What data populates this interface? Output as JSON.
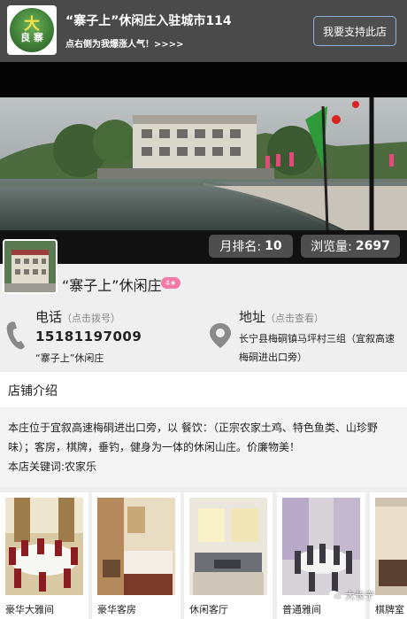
{
  "topbar": {
    "logo_text_main": "大",
    "logo_text_sub": "良 寨",
    "title": "“寨子上”休闲庄入驻城市114",
    "subtitle": "点右侧为我爆涨人气！>>>>",
    "support_label": "我要支持此店"
  },
  "stats": {
    "rank_label": "月排名:",
    "rank_value": "10",
    "views_label": "浏览量:",
    "views_value": "2697"
  },
  "shop": {
    "name": "“寨子上”休闲庄",
    "badge": "4★"
  },
  "contact": {
    "phone_title": "电话",
    "phone_hint": "（点击拨号）",
    "phone_number": "15181197009",
    "phone_name": "“寨子上”休闲庄",
    "addr_title": "地址",
    "addr_hint": "（点击查看）",
    "addr_text": "长宁县梅硐镇马坪村三组（宜叙高速梅硐进出口旁）"
  },
  "intro": {
    "heading": "店铺介绍",
    "body": "本庄位于宜叙高速梅硐进出口旁，以 餐饮：（正宗农家土鸡、特色鱼类、山珍野味）；客房，棋牌，垂钓，健身为一体的休闲山庄。价廉物美！",
    "keywords": "本店关键词:农家乐"
  },
  "gallery": [
    {
      "caption": "豪华大雅间"
    },
    {
      "caption": "豪华客房"
    },
    {
      "caption": "休闲客厅"
    },
    {
      "caption": "普通雅间"
    },
    {
      "caption": "棋牌室"
    }
  ],
  "watermark": "大长宁",
  "colors": {
    "topbar": "#4a4a4a",
    "support_border": "#8fb3d9",
    "badge": "#f27aa6",
    "stat_bg": "#4e4e4e"
  }
}
